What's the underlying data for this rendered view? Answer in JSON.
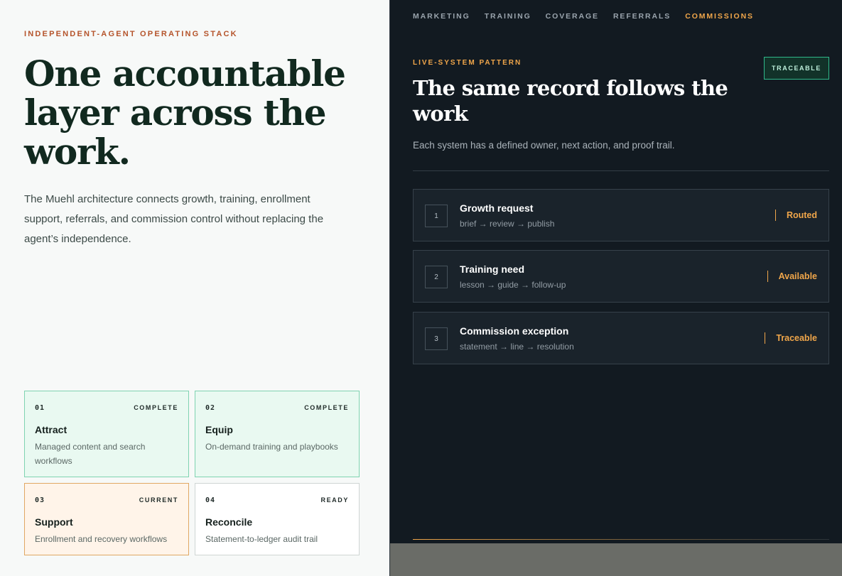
{
  "left": {
    "eyebrow": "INDEPENDENT-AGENT OPERATING STACK",
    "headline": "One accountable layer across the work.",
    "lede": "The Muehl architecture connects growth, training, enrollment support, referrals, and commission control without replacing the agent’s independence.",
    "stages": [
      {
        "num": "01",
        "status": "COMPLETE",
        "title": "Attract",
        "desc": "Managed content and search workflows"
      },
      {
        "num": "02",
        "status": "COMPLETE",
        "title": "Equip",
        "desc": "On-demand training and playbooks"
      },
      {
        "num": "03",
        "status": "CURRENT",
        "title": "Support",
        "desc": "Enrollment and recovery workflows"
      },
      {
        "num": "04",
        "status": "READY",
        "title": "Reconcile",
        "desc": "Statement-to-ledger audit trail"
      }
    ]
  },
  "right": {
    "nav": [
      "MARKETING",
      "TRAINING",
      "COVERAGE",
      "REFERRALS",
      "COMMISSIONS"
    ],
    "active_nav": "COMMISSIONS",
    "eyebrow": "LIVE-SYSTEM PATTERN",
    "title": "The same record follows the work",
    "subtitle": "Each system has a defined owner, next action, and proof trail.",
    "badge": "TRACEABLE",
    "rows": [
      {
        "num": "1",
        "title": "Growth request",
        "path": "brief → review → publish",
        "status": "Routed"
      },
      {
        "num": "2",
        "title": "Training need",
        "path": "lesson → guide → follow-up",
        "status": "Available"
      },
      {
        "num": "3",
        "title": "Commission exception",
        "path": "statement → line → resolution",
        "status": "Traceable"
      }
    ]
  },
  "colors": {
    "accent": "#f0a64a",
    "eyebrow_left": "#b5542b",
    "headline": "#11291f",
    "dark_bg": "#121a21",
    "complete_bg": "#e9f9f1",
    "current_bg": "#fff4e9"
  }
}
